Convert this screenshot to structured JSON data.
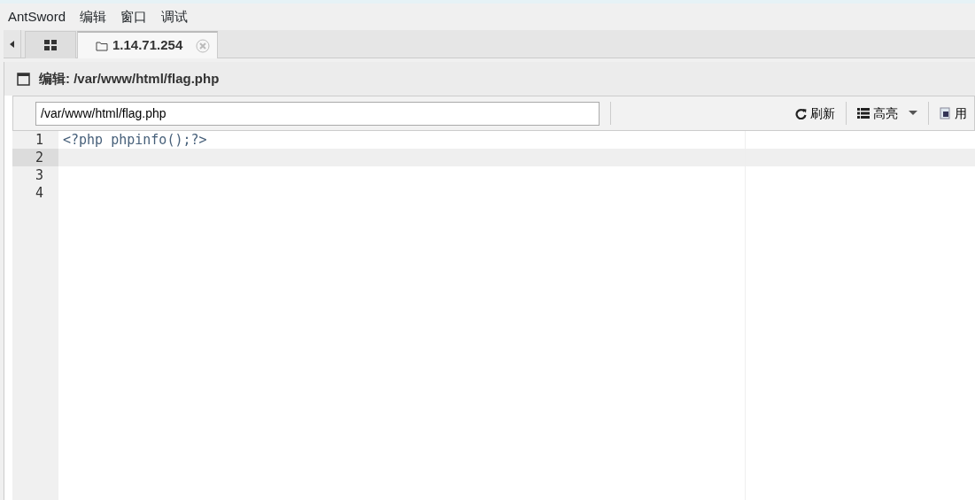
{
  "menu": [
    "AntSword",
    "编辑",
    "窗口",
    "调试"
  ],
  "tabs": [
    {
      "kind": "home",
      "selected": false
    },
    {
      "kind": "folder",
      "label": "1.14.71.254",
      "selected": true
    }
  ],
  "panel": {
    "title": "编辑: /var/www/html/flag.php"
  },
  "toolbar": {
    "path_value": "/var/www/html/flag.php",
    "buttons": [
      {
        "kind": "refresh",
        "label": "刷新"
      },
      {
        "kind": "highlight",
        "label": "高亮"
      },
      {
        "kind": "user",
        "label": "用"
      }
    ]
  },
  "editor": {
    "lines": [
      {
        "number": "1",
        "code": "<?php phpinfo();?>",
        "selected": false
      },
      {
        "number": "2",
        "selected": true
      },
      {
        "number": "3",
        "selected": false
      },
      {
        "number": "4",
        "selected": false
      }
    ]
  }
}
